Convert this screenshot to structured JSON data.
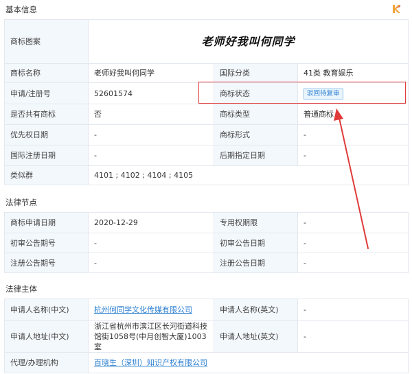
{
  "sections": {
    "basic": "基本信息",
    "legal_nodes": "法律节点",
    "legal_subject": "法律主体"
  },
  "basic": {
    "image_label": "商标图案",
    "image_text": "老师好我叫何同学",
    "name_label": "商标名称",
    "name_value": "老师好我叫何同学",
    "class_label": "国际分类",
    "class_value": "41类 教育娱乐",
    "reg_label": "申请/注册号",
    "reg_value": "52601574",
    "status_label": "商标状态",
    "status_value": "驳回待复审",
    "shared_label": "是否共有商标",
    "shared_value": "否",
    "type_label": "商标类型",
    "type_value": "普通商标",
    "priority_label": "优先权日期",
    "priority_value": "-",
    "form_label": "商标形式",
    "form_value": "-",
    "intl_reg_label": "国际注册日期",
    "intl_reg_value": "-",
    "later_label": "后期指定日期",
    "later_value": "-",
    "similar_label": "类似群",
    "similar_value": "4101 ; 4102 ; 4104 ; 4105"
  },
  "legal": {
    "apply_date_label": "商标申请日期",
    "apply_date_value": "2020-12-29",
    "exclusive_label": "专用权期限",
    "exclusive_value": "-",
    "prelim_no_label": "初审公告期号",
    "prelim_no_value": "-",
    "prelim_date_label": "初审公告日期",
    "prelim_date_value": "-",
    "reg_no_label": "注册公告期号",
    "reg_no_value": "-",
    "reg_date_label": "注册公告日期",
    "reg_date_value": "-"
  },
  "subject": {
    "applicant_cn_label": "申请人名称(中文)",
    "applicant_cn_value": "杭州何同学文化传媒有限公司",
    "applicant_en_label": "申请人名称(英文)",
    "applicant_en_value": "-",
    "address_cn_label": "申请人地址(中文)",
    "address_cn_value": "浙江省杭州市滨江区长河街道科技馆街1058号(中月创智大厦)1003室",
    "address_en_label": "申请人地址(英文)",
    "address_en_value": "-",
    "agent_label": "代理/办理机构",
    "agent_value": "百晓生（深圳）知识产权有限公司"
  },
  "colors": {
    "label_bg": "#f3f8fd",
    "border": "#e4e8ef",
    "link": "#2c7fd1",
    "annotation": "#e03a3a"
  },
  "icons": {
    "logo": "k-logo-icon",
    "annotation_arrow": "red-arrow-annotation"
  }
}
